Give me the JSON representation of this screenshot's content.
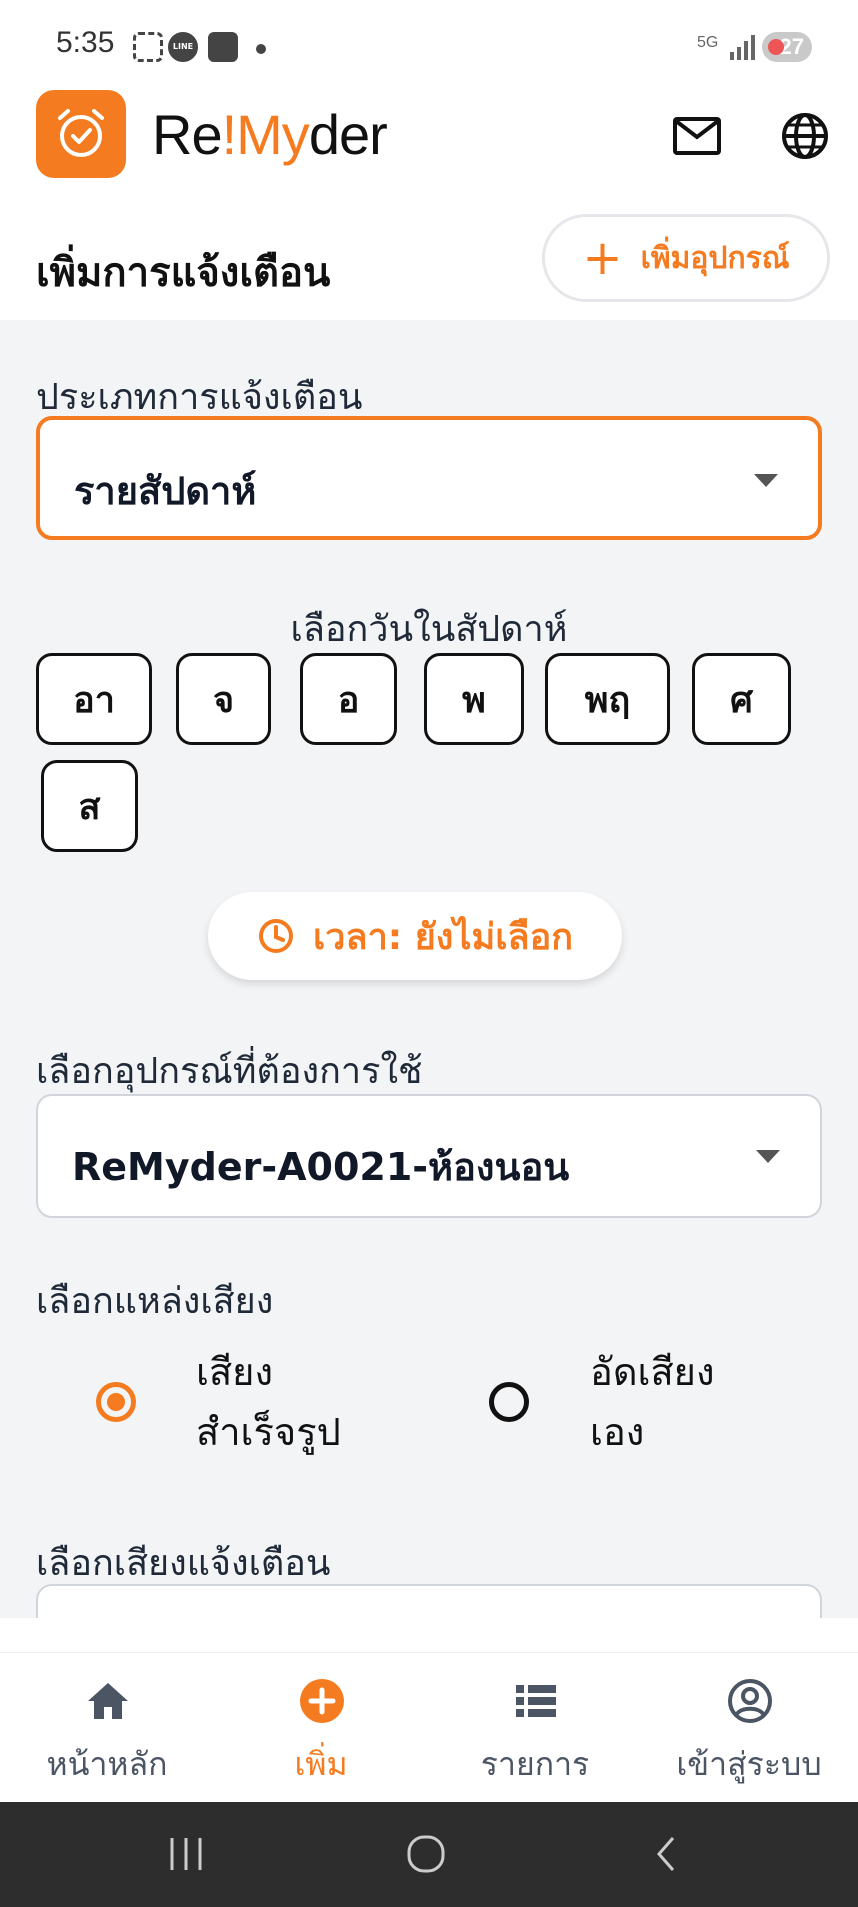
{
  "status_bar": {
    "time": "5:35",
    "network": "5G",
    "battery": "27"
  },
  "header": {
    "brand_prefix": "Re",
    "brand_accent": "!My",
    "brand_suffix": "der",
    "accent_color": "#f47b20"
  },
  "title_row": {
    "title": "เพิ่มการแจ้งเตือน",
    "add_device_label": "เพิ่มอุปกรณ์"
  },
  "form": {
    "alert_type_label": "ประเภทการแจ้งเตือน",
    "alert_type_value": "รายสัปดาห์",
    "days_label": "เลือกวันในสัปดาห์",
    "days": [
      "อา",
      "จ",
      "อ",
      "พ",
      "พฤ",
      "ศ",
      "ส"
    ],
    "time_label": "เวลา: ยังไม่เลือก",
    "device_label": "เลือกอุปกรณ์ที่ต้องการใช้",
    "device_value": "ReMyder-A0021-ห้องนอน",
    "sound_source_label": "เลือกแหล่งเสียง",
    "sound_options": [
      {
        "line1": "เสียง",
        "line2": "สำเร็จรูป",
        "checked": true
      },
      {
        "line1": "อัดเสียง",
        "line2": "เอง",
        "checked": false
      }
    ],
    "alert_sound_label": "เลือกเสียงแจ้งเตือน"
  },
  "bottom_nav": {
    "items": [
      {
        "label": "หน้าหลัก",
        "icon": "home-icon",
        "active": false
      },
      {
        "label": "เพิ่ม",
        "icon": "plus-circle-icon",
        "active": true
      },
      {
        "label": "รายการ",
        "icon": "list-icon",
        "active": false
      },
      {
        "label": "เข้าสู่ระบบ",
        "icon": "account-icon",
        "active": false
      }
    ]
  }
}
